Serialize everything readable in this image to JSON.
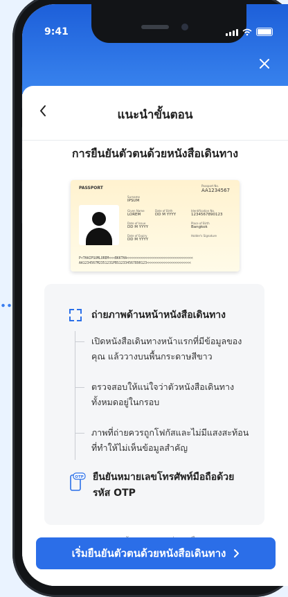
{
  "status_bar": {
    "time": "9:41"
  },
  "header": {
    "title": "แนะนำขั้นตอน"
  },
  "section_title": "การยืนยันตัวตนด้วยหนังสือเดินทาง",
  "passport": {
    "label": "PASSPORT",
    "number_label": "Passport No.",
    "number": "AA1234567",
    "surname_label": "Surname",
    "surname": "IPSUM",
    "given_label": "Given Name",
    "given": "LOREM",
    "dob_label": "Date of Birth",
    "dob": "DD M YYYY",
    "id_label": "Identification No.",
    "id": "1234567890123",
    "issue_label": "Date of Issue",
    "issue": "DD M YYYY",
    "pob_label": "Place of Birth",
    "pob": "Bangkok",
    "expiry_label": "Date of Expiry",
    "expiry": "DD M YYYY",
    "signature_label": "Holder's Signature",
    "mrz1": "P<THAIPSUMLOREM<<<BKKTHA<<<<<<<<<<<<<<<<<<<<<<<<<<<<<<<<<",
    "mrz2": "AA1234567M2351231PBS12334567890123<<<<<<<<<<<<<<<<<<<<<<"
  },
  "instructions": {
    "step_title": "ถ่ายภาพด้านหน้าหนังสือเดินทาง",
    "items": [
      "เปิดหนังสือเดินทางหน้าแรกที่มีข้อมูลของคุณ แล้ววางบนพื้นกระดาษสีขาว",
      "ตรวจสอบให้แน่ใจว่าตัวหนังสือเดินทางทั้งหมดอยู่ในกรอบ",
      "ภาพที่ถ่ายควรถูกโฟกัสและไม่มีแสงสะท้อนที่ทำให้ไม่เห็นข้อมูลสำคัญ"
    ],
    "otp_title": "ยืนยันหมายเลขโทรศัพท์มือถือด้วยรหัส OTP",
    "otp_badge": "OTP"
  },
  "help_text": "หากต้องการความช่วยเหลือ",
  "cta": {
    "label": "เริ่มยืนยันตัวตนด้วยหนังสือเดินทาง"
  },
  "colors": {
    "primary": "#2b6ee8",
    "header_gradient_top": "#1d5fd9"
  }
}
